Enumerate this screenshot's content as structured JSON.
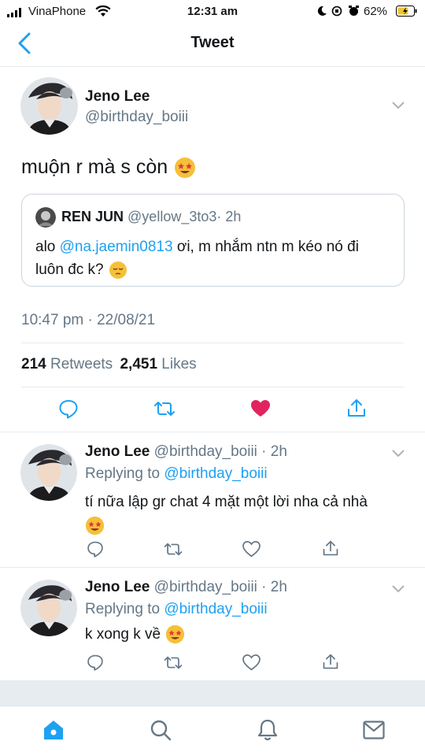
{
  "status_bar": {
    "carrier": "VinaPhone",
    "time": "12:31 am",
    "battery": "62%"
  },
  "nav": {
    "title": "Tweet"
  },
  "tweet": {
    "name": "Jeno Lee",
    "handle": "@birthday_boiii",
    "text": "muộn r mà s còn",
    "quoted": {
      "name": "REN JUN",
      "handle": "@yellow_3to3",
      "time": "· 2h",
      "text_prefix": "alo ",
      "mention": "@na.jaemin0813",
      "text_suffix": " ơi, m nhắm ntn m kéo nó đi",
      "text_line2": "luôn đc k?"
    },
    "timestamp": "10:47 pm · 22/08/21",
    "retweets_count": "214",
    "retweets_label": "Retweets",
    "likes_count": "2,451",
    "likes_label": "Likes"
  },
  "replies": [
    {
      "name": "Jeno Lee",
      "handle_time": "@birthday_boiii · 2h",
      "replying_label": "Replying to",
      "replying_to": "@birthday_boiii",
      "text_line1": "tí nữa lập gr chat 4 mặt một lời nha cả nhà",
      "text_line2": ""
    },
    {
      "name": "Jeno Lee",
      "handle_time": "@birthday_boiii · 2h",
      "replying_label": "Replying to",
      "replying_to": "@birthday_boiii",
      "text_line1": "k xong k về"
    }
  ],
  "colors": {
    "accent": "#1da1f2",
    "like_active": "#e0245e",
    "muted": "#657786",
    "divider": "#e6ecf0"
  }
}
